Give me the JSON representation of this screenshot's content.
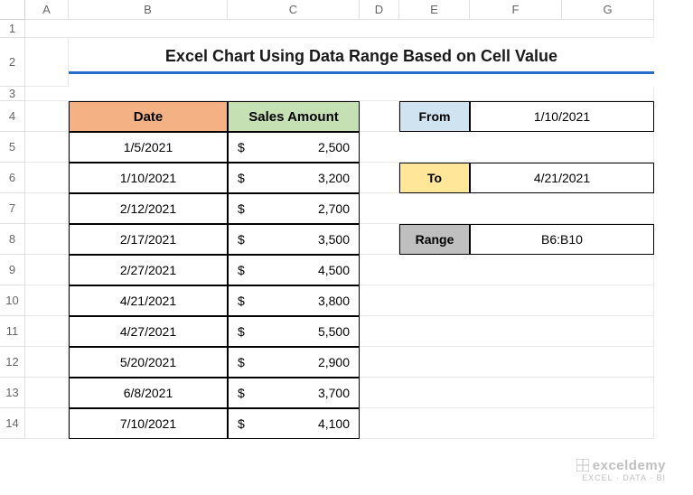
{
  "columns": [
    "A",
    "B",
    "C",
    "D",
    "E",
    "F",
    "G"
  ],
  "rows": [
    "1",
    "2",
    "3",
    "4",
    "5",
    "6",
    "7",
    "8",
    "9",
    "10",
    "11",
    "12",
    "13",
    "14"
  ],
  "title": "Excel Chart Using Data Range Based on Cell Value",
  "table": {
    "headers": {
      "date": "Date",
      "amount": "Sales Amount"
    },
    "currency": "$",
    "data": [
      {
        "date": "1/5/2021",
        "amount": "2,500"
      },
      {
        "date": "1/10/2021",
        "amount": "3,200"
      },
      {
        "date": "2/12/2021",
        "amount": "2,700"
      },
      {
        "date": "2/17/2021",
        "amount": "3,500"
      },
      {
        "date": "2/27/2021",
        "amount": "4,500"
      },
      {
        "date": "4/21/2021",
        "amount": "3,800"
      },
      {
        "date": "4/27/2021",
        "amount": "5,500"
      },
      {
        "date": "5/20/2021",
        "amount": "2,900"
      },
      {
        "date": "6/8/2021",
        "amount": "3,700"
      },
      {
        "date": "7/10/2021",
        "amount": "4,100"
      }
    ]
  },
  "params": {
    "from": {
      "label": "From",
      "value": "1/10/2021"
    },
    "to": {
      "label": "To",
      "value": "4/21/2021"
    },
    "range": {
      "label": "Range",
      "value": "B6:B10"
    }
  },
  "watermark": {
    "brand": "exceldemy",
    "tag": "EXCEL · DATA · BI"
  }
}
